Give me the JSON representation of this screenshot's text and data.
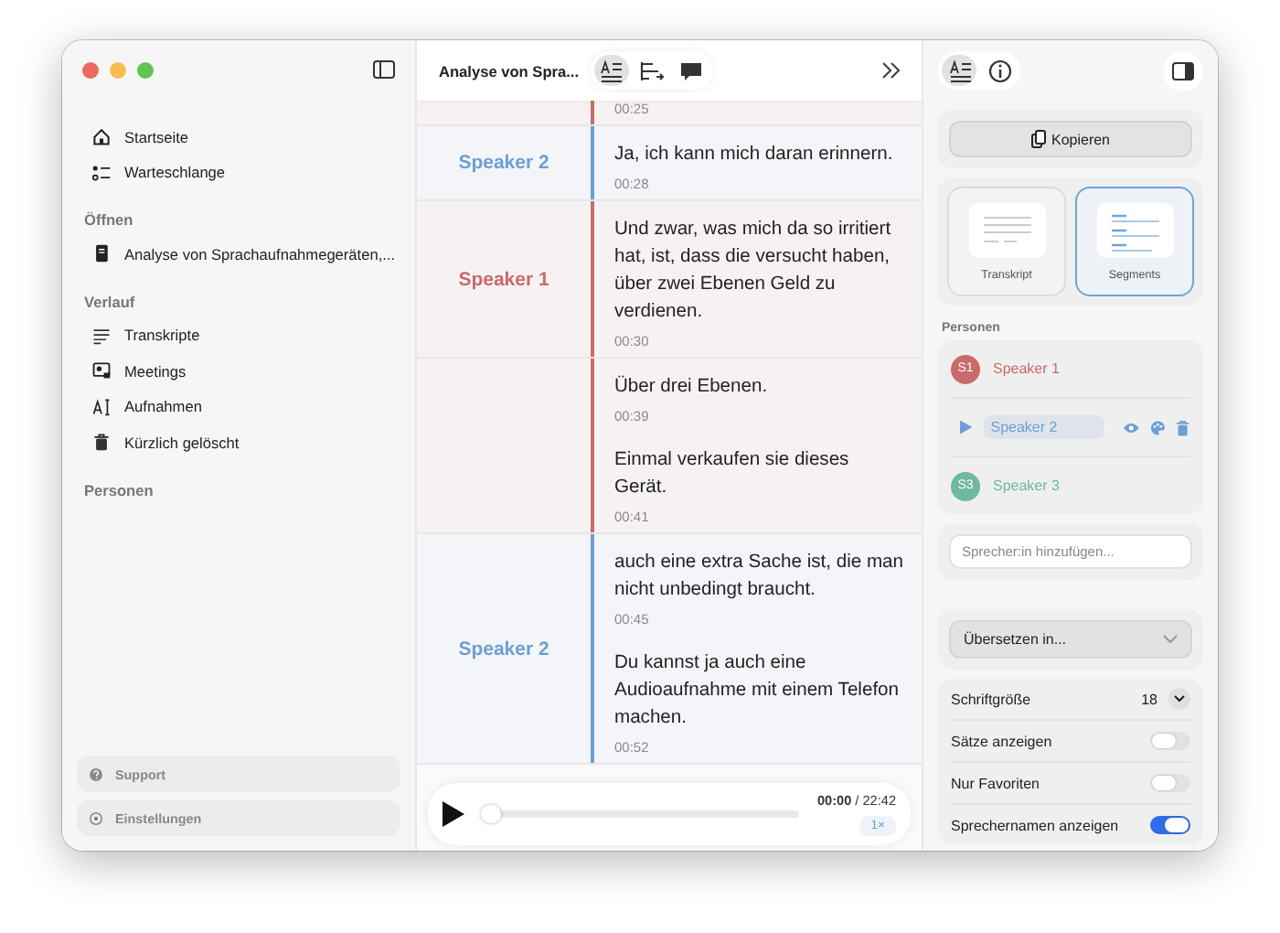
{
  "sidebar": {
    "nav": [
      {
        "label": "Startseite",
        "kind": "home"
      },
      {
        "label": "Warteschlange",
        "kind": "queue"
      }
    ],
    "sections": [
      {
        "title": "Öffnen",
        "items": [
          {
            "label": "Analyse von Sprachaufnahmegeräten,...",
            "kind": "document"
          }
        ]
      },
      {
        "title": "Verlauf",
        "items": [
          {
            "label": "Transkripte",
            "kind": "lines"
          },
          {
            "label": "Meetings",
            "kind": "meeting"
          },
          {
            "label": "Aufnahmen",
            "kind": "textcursor"
          },
          {
            "label": "Kürzlich gelöscht",
            "kind": "trash"
          }
        ]
      },
      {
        "title": "Personen"
      }
    ],
    "footer": [
      {
        "label": "Support",
        "kind": "help"
      },
      {
        "label": "Einstellungen",
        "kind": "settings"
      }
    ]
  },
  "transcript": {
    "title": "Analyse von Spra...",
    "views": [
      {
        "kind": "transcript",
        "selected": true
      },
      {
        "kind": "chapters",
        "selected": false
      },
      {
        "kind": "comments",
        "selected": false
      }
    ],
    "groups": [
      {
        "color": "#c96b6b",
        "entries": [
          {
            "time": "00:25"
          }
        ]
      },
      {
        "speaker": "Speaker 2",
        "color": "#6d9fd4",
        "entries": [
          {
            "text": "Ja, ich kann mich daran erinnern.",
            "time": "00:28"
          }
        ]
      },
      {
        "speaker": "Speaker 1",
        "color": "#c96b6b",
        "entries": [
          {
            "text": "Und zwar, was mich da so irritiert hat, ist, dass die versucht haben, über zwei Ebenen Geld zu verdienen.",
            "time": "00:30"
          }
        ]
      },
      {
        "color": "#c96b6b",
        "entries": [
          {
            "text": "Über drei Ebenen.",
            "time": "00:39"
          },
          {
            "text": "Einmal verkaufen sie dieses Gerät.",
            "time": "00:41"
          }
        ]
      },
      {
        "speaker": "Speaker 2",
        "color": "#6d9fd4",
        "entries": [
          {
            "text": "auch eine extra Sache ist, die man nicht unbedingt braucht.",
            "time": "00:45"
          },
          {
            "text": "Du kannst ja auch eine Audioaufnahme mit einem Telefon machen.",
            "time": "00:52"
          }
        ]
      }
    ],
    "player": {
      "level": 0,
      "time": "**00:00** / 22:42",
      "speed": "1×"
    }
  },
  "inspector": {
    "tabs": [
      {
        "kind": "text",
        "selected": true
      },
      {
        "kind": "info",
        "selected": false
      }
    ],
    "copy_button": "Kopieren",
    "formats": [
      {
        "label": "Transkript",
        "selected": false
      },
      {
        "label": "Segments",
        "selected": true
      }
    ],
    "persons_title": "Personen",
    "persons": [
      {
        "initials": "S1",
        "name": "Speaker 1",
        "color": "#c96b6b",
        "editing": false
      },
      {
        "name": "Speaker 2",
        "color": "#6d9fd4",
        "editing": true
      },
      {
        "initials": "S3",
        "name": "Speaker 3",
        "color": "#6fb8a2",
        "editing": false
      }
    ],
    "add_person": {
      "placeholder": "Sprecher:in hinzufügen..."
    },
    "translate": "Übersetzen in...",
    "settings": [
      {
        "kind": "stepper",
        "label": "Schriftgröße",
        "value": "18"
      },
      {
        "kind": "toggle",
        "label": "Sätze anzeigen",
        "on": false
      },
      {
        "kind": "toggle",
        "label": "Nur Favoriten",
        "on": false
      },
      {
        "kind": "toggle",
        "label": "Sprechernamen anzeigen",
        "on": true
      }
    ]
  }
}
